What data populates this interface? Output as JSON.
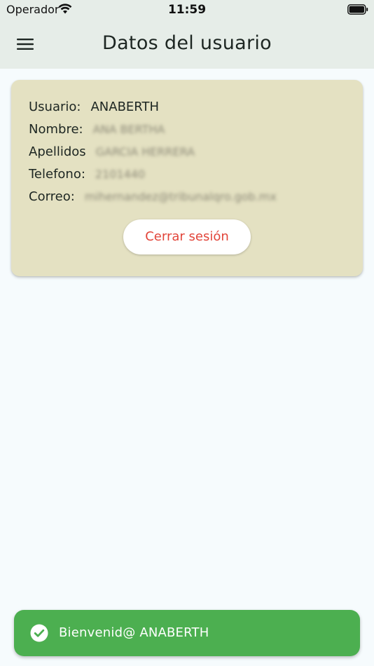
{
  "status_bar": {
    "carrier": "Operador",
    "time": "11:59"
  },
  "app_bar": {
    "title": "Datos del usuario",
    "menu_icon": "hamburger-menu-icon"
  },
  "user_card": {
    "rows": [
      {
        "label": "Usuario:",
        "value": "ANABERTH"
      },
      {
        "label": "Nombre:",
        "value": "ANA BERTHA"
      },
      {
        "label": "Apellidos",
        "value": "GARCIA HERRERA"
      },
      {
        "label": "Telefono:",
        "value": "2101440"
      },
      {
        "label": "Correo:",
        "value": "mihernandez@tribunalqro.gob.mx"
      }
    ],
    "logout_label": "Cerrar sesión"
  },
  "snackbar": {
    "message": "Bienvenid@ ANABERTH",
    "icon": "check-circle-icon"
  },
  "colors": {
    "app_bar_bg": "#e6ede8",
    "card_bg": "#e4e1c2",
    "logout_text": "#e2453a",
    "snackbar_bg": "#4caf50",
    "page_bg": "#f6fbfd"
  }
}
